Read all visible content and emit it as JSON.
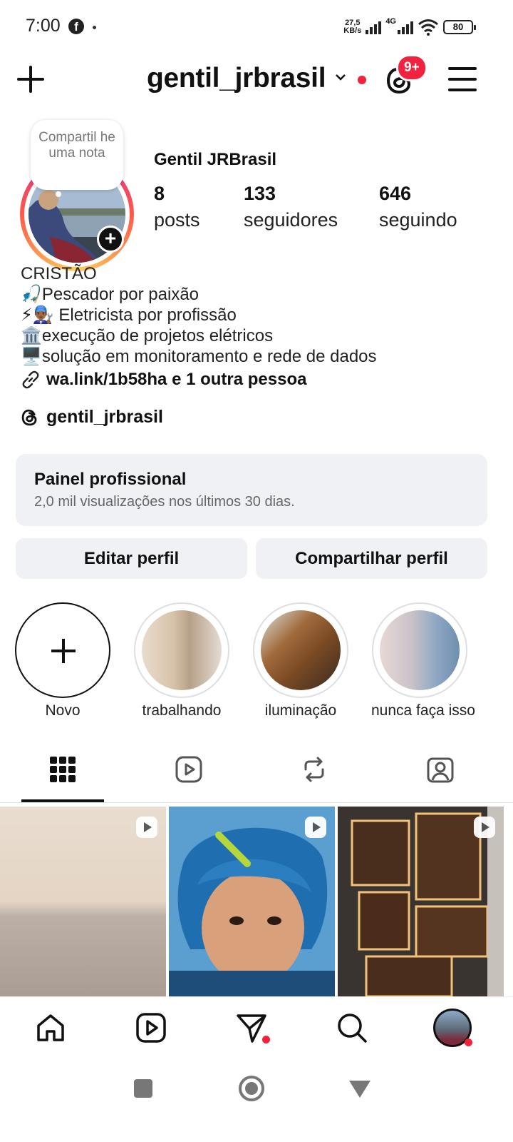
{
  "status_bar": {
    "time": "7:00",
    "speed_value": "27,5",
    "speed_unit": "KB/s",
    "network": "4G",
    "battery": "80",
    "icons": [
      "facebook-icon",
      "signal-icon",
      "wifi-icon",
      "battery-icon"
    ]
  },
  "header": {
    "username": "gentil_jrbrasil",
    "threads_badge": "9+",
    "icons": [
      "plus-icon",
      "chevron-down-icon",
      "threads-icon",
      "menu-icon"
    ]
  },
  "profile": {
    "note": "Compartil he uma nota",
    "display_name": "Gentil JRBrasil",
    "stats": [
      {
        "value": "8",
        "label": "posts"
      },
      {
        "value": "133",
        "label": "seguidores"
      },
      {
        "value": "646",
        "label": "seguindo"
      }
    ],
    "bio": [
      {
        "emoji": "",
        "text": "CRISTÃO"
      },
      {
        "emoji": "🎣",
        "text": "Pescador por paixão"
      },
      {
        "emoji": "⚡👨🏾‍🔧",
        "text": " Eletricista por profissão"
      },
      {
        "emoji": "🏛️",
        "text": "execução de projetos elétricos"
      },
      {
        "emoji": "🖥️",
        "text": "solução em monitoramento e rede de dados"
      }
    ],
    "link": "wa.link/1b58ha e 1 outra pessoa",
    "threads_handle": "gentil_jrbrasil"
  },
  "dashboard": {
    "title": "Painel profissional",
    "subtitle": "2,0 mil visualizações nos últimos 30 dias."
  },
  "buttons": {
    "edit": "Editar perfil",
    "share": "Compartilhar perfil"
  },
  "highlights": [
    {
      "label": "Novo"
    },
    {
      "label": "trabalhando"
    },
    {
      "label": "iluminação"
    },
    {
      "label": "nunca faça isso"
    }
  ],
  "tabs": [
    "grid-icon",
    "reels-icon",
    "reposts-icon",
    "tagged-icon"
  ],
  "accent_color": "#f0223d"
}
